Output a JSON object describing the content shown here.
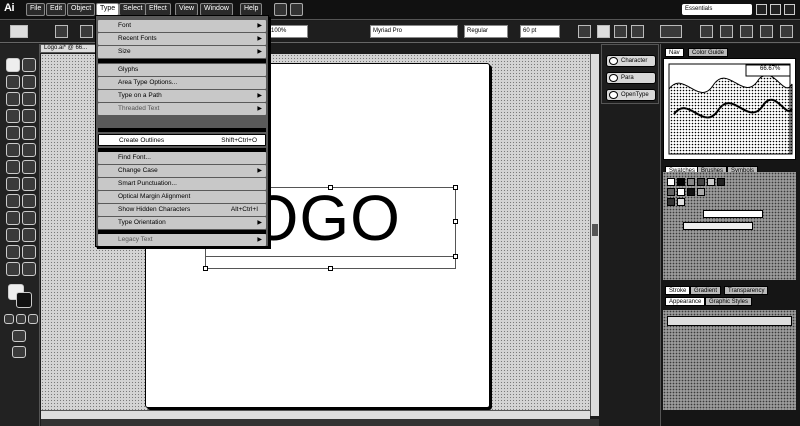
{
  "app": {
    "logo": "Ai"
  },
  "menubar": {
    "items": [
      "File",
      "Edit",
      "Object",
      "Type",
      "Select",
      "Effect",
      "View",
      "Window",
      "Help"
    ],
    "active": "Type",
    "search_value": "Essentials"
  },
  "controlbar": {
    "zoom": "100%",
    "font_family": "Myriad Pro",
    "font_style": "Regular",
    "font_size": "60 pt"
  },
  "document": {
    "tab_label": "Logo.ai* @ 66..."
  },
  "artboard": {
    "logo_text": "LOGO"
  },
  "type_menu": {
    "groups": [
      [
        {
          "label": "Font",
          "submenu": true,
          "enabled": true
        },
        {
          "label": "Recent Fonts",
          "submenu": true,
          "enabled": true
        },
        {
          "label": "Size",
          "submenu": true,
          "enabled": true
        }
      ],
      [
        {
          "label": "Glyphs",
          "submenu": false,
          "enabled": true
        },
        {
          "label": "Area Type Options...",
          "submenu": false,
          "enabled": true
        },
        {
          "label": "Type on a Path",
          "submenu": true,
          "enabled": true
        },
        {
          "label": "Threaded Text",
          "submenu": true,
          "enabled": false
        }
      ],
      [
        {
          "label": "Create Outlines",
          "submenu": false,
          "enabled": true,
          "shortcut": "Shift+Ctrl+O",
          "highlighted": true
        }
      ],
      [
        {
          "label": "Find Font...",
          "submenu": false,
          "enabled": true
        },
        {
          "label": "Change Case",
          "submenu": true,
          "enabled": true
        },
        {
          "label": "Smart Punctuation...",
          "submenu": false,
          "enabled": true
        },
        {
          "label": "Optical Margin Alignment",
          "submenu": false,
          "enabled": true
        },
        {
          "label": "Show Hidden Characters",
          "submenu": false,
          "enabled": true,
          "shortcut": "Alt+Ctrl+I"
        },
        {
          "label": "Type Orientation",
          "submenu": true,
          "enabled": true
        }
      ],
      [
        {
          "label": "Legacy Text",
          "submenu": true,
          "enabled": false
        }
      ]
    ]
  },
  "mini_panel": {
    "items": [
      "Character",
      "Para",
      "OpenType"
    ]
  },
  "right_panels": {
    "navigator_tabs": [
      "Nav",
      "Color Guide"
    ],
    "zoom_value": "66.67%",
    "swatch_tabs": [
      "Swatches",
      "Brushes",
      "Symbols"
    ],
    "stroke_tabs": [
      "Stroke",
      "Gradient",
      "Transparency"
    ],
    "appearance_tabs": [
      "Appearance",
      "Graphic Styles"
    ]
  }
}
